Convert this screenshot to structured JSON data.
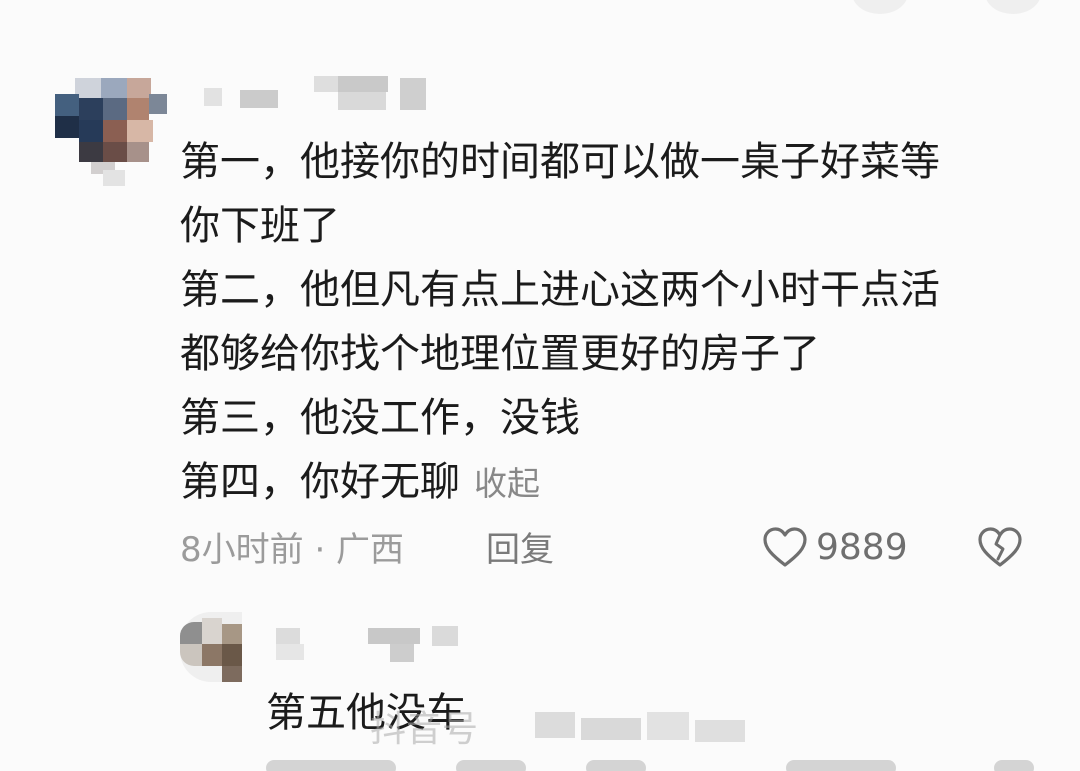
{
  "comment": {
    "lines": [
      "第一，他接你的时间都可以做一桌子好菜等",
      "你下班了",
      "第二，他但凡有点上进心这两个小时干点活",
      "都够给你找个地理位置更好的房子了",
      "第三，他没工作，没钱",
      "第四，你好无聊"
    ],
    "collapse_label": "收起",
    "time_location": "8小时前 · 广西",
    "reply_label": "回复",
    "like_count": "9889",
    "like_icon": "heart-outline-icon",
    "dislike_icon": "broken-heart-icon"
  },
  "reply": {
    "text": "第五他没车"
  },
  "watermark": {
    "text": "抖音号"
  },
  "colors": {
    "background": "#fbfbfb",
    "text": "#1b1b1b",
    "meta": "#9b9b9b",
    "icon": "#6f6f6f"
  }
}
